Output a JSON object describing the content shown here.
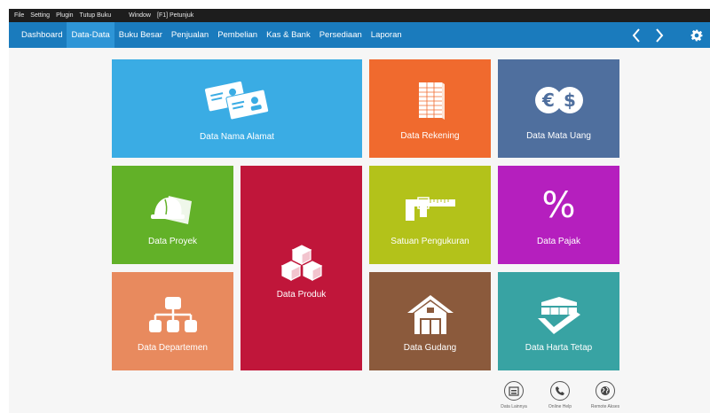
{
  "menubar": {
    "items": [
      "File",
      "Setting",
      "Plugin",
      "Tutup Buku",
      "Window",
      "[F1] Petunjuk"
    ]
  },
  "navbar": {
    "items": [
      "Dashboard",
      "Data-Data",
      "Buku Besar",
      "Penjualan",
      "Pembelian",
      "Kas & Bank",
      "Persediaan",
      "Laporan"
    ],
    "active": "Data-Data"
  },
  "tiles": {
    "nama_alamat": {
      "label": "Data Nama Alamat",
      "icon": "address-cards-icon",
      "color": "#3aace4"
    },
    "rekening": {
      "label": "Data Rekening",
      "icon": "ledger-icon",
      "color": "#f06a2e"
    },
    "mata_uang": {
      "label": "Data Mata Uang",
      "icon": "currency-icon",
      "color": "#4f6f9e"
    },
    "proyek": {
      "label": "Data Proyek",
      "icon": "helmet-icon",
      "color": "#62b128"
    },
    "produk": {
      "label": "Data Produk",
      "icon": "boxes-icon",
      "color": "#c0163a"
    },
    "satuan": {
      "label": "Satuan Pengukuran",
      "icon": "caliper-icon",
      "color": "#b3c21a"
    },
    "pajak": {
      "label": "Data Pajak",
      "icon": "percent-icon",
      "color": "#b51fbe"
    },
    "departemen": {
      "label": "Data Departemen",
      "icon": "org-chart-icon",
      "color": "#e88a5e"
    },
    "gudang": {
      "label": "Data Gudang",
      "icon": "warehouse-icon",
      "color": "#8b5a3c"
    },
    "harta": {
      "label": "Data Harta Tetap",
      "icon": "asset-check-icon",
      "color": "#38a3a3"
    }
  },
  "footer": {
    "lainnya": "Data Lainnya",
    "help": "Online Help",
    "remote": "Remote Akses"
  }
}
